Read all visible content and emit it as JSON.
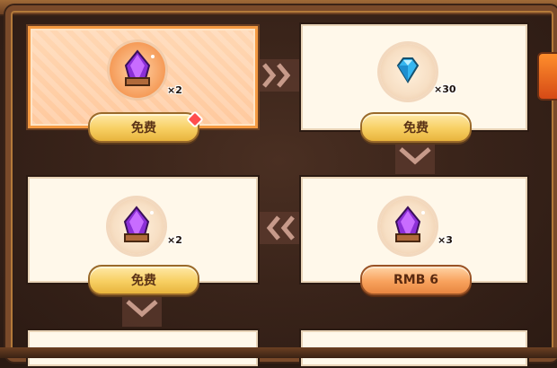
{
  "cards": [
    {
      "qty": "×2",
      "button": "免费",
      "item_icon": "purple-crystal-icon",
      "selected": true,
      "has_red_dot": true
    },
    {
      "qty": "×30",
      "button": "免费",
      "item_icon": "blue-diamond-icon",
      "selected": false
    },
    {
      "qty": "×2",
      "button": "免费",
      "item_icon": "purple-crystal-icon",
      "selected": false
    },
    {
      "qty": "×3",
      "button": "RMB 6",
      "item_icon": "purple-crystal-icon",
      "selected": false
    }
  ],
  "colors": {
    "button_gold": "#f7cf62",
    "button_orange": "#f8a25d",
    "selected_border": "#f59a42",
    "red_dot": "#ff4d4d"
  }
}
